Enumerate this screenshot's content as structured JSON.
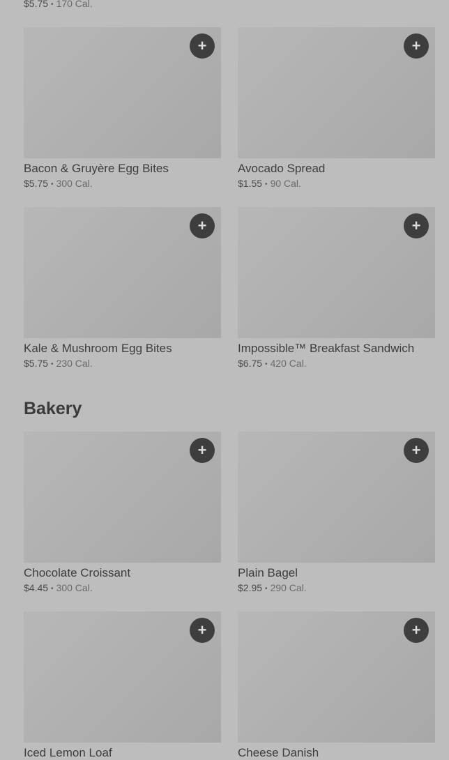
{
  "top_item": {
    "price": "$5.75",
    "calories": "170 Cal."
  },
  "add_glyph": "+",
  "separator": "•",
  "rows_a": [
    {
      "name": "Bacon & Gruyère Egg Bites",
      "price": "$5.75",
      "calories": "300 Cal."
    },
    {
      "name": "Avocado Spread",
      "price": "$1.55",
      "calories": "90 Cal."
    },
    {
      "name": "Kale & Mushroom Egg Bites",
      "price": "$5.75",
      "calories": "230 Cal."
    },
    {
      "name": "Impossible™ Breakfast Sandwich",
      "price": "$6.75",
      "calories": "420 Cal."
    }
  ],
  "bakery": {
    "title": "Bakery",
    "items": [
      {
        "name": "Chocolate Croissant",
        "price": "$4.45",
        "calories": "300 Cal."
      },
      {
        "name": "Plain Bagel",
        "price": "$2.95",
        "calories": "290 Cal."
      },
      {
        "name": "Iced Lemon Loaf",
        "price": "",
        "calories": ""
      },
      {
        "name": "Cheese Danish",
        "price": "",
        "calories": ""
      }
    ]
  }
}
